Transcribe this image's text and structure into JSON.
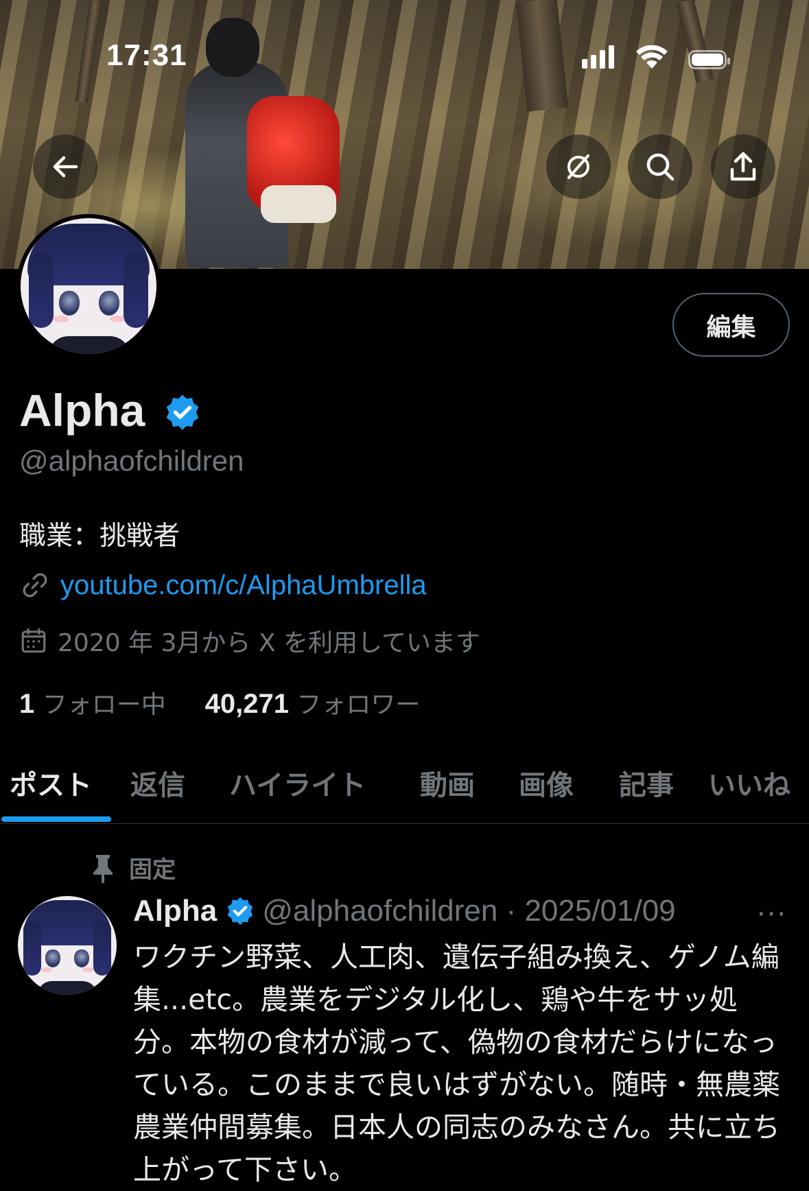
{
  "status_bar": {
    "time": "17:31"
  },
  "banner": {
    "buttons": [
      "back-arrow-icon",
      "circle-slash-icon",
      "search-icon",
      "share-icon"
    ]
  },
  "profile": {
    "edit_label": "編集",
    "display_name": "Alpha",
    "handle": "@alphaofchildren",
    "bio": "職業：挑戦者",
    "link": "youtube.com/c/AlphaUmbrella",
    "joined": "2020 年 3月から X を利用しています",
    "following_count": "1",
    "following_label": "フォロー中",
    "followers_count": "40,271",
    "followers_label": "フォロワー",
    "verified_color": "#1d9bf0"
  },
  "tabs": [
    {
      "label": "ポスト",
      "active": true
    },
    {
      "label": "返信"
    },
    {
      "label": "ハイライト"
    },
    {
      "label": "動画"
    },
    {
      "label": "画像"
    },
    {
      "label": "記事"
    },
    {
      "label": "いいね"
    }
  ],
  "pinned_post": {
    "pin_label": "固定",
    "author": "Alpha",
    "handle_date": "@alphaofchildren · 2025/01/09",
    "more": "···",
    "text": "ワクチン野菜、人工肉、遺伝子組み換え、ゲノム編集...etc。農業をデジタル化し、鶏や牛をサッ処分。本物の食材が減って、偽物の食材だらけになっている。このままで良いはずがない。随時・無農薬農業仲間募集。日本人の同志のみなさん。共に立ち上がって下さい。"
  }
}
